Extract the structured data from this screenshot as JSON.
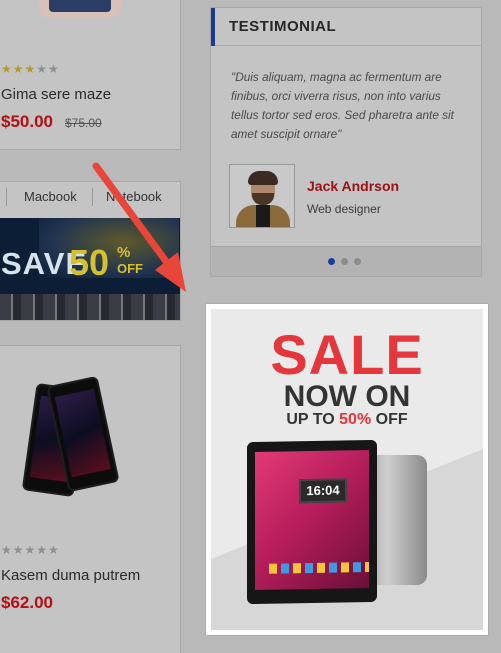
{
  "products": [
    {
      "name": "Gima sere maze",
      "price": "$50.00",
      "old_price": "$75.00",
      "rating": 3,
      "max_rating": 5
    },
    {
      "name": "Kasem duma putrem",
      "price": "$62.00",
      "old_price": "",
      "rating": 0,
      "max_rating": 5
    }
  ],
  "tabs": [
    "Macbook",
    "Notebook"
  ],
  "banner": {
    "save": "SAVE",
    "percent": "50",
    "percent_sign": "%",
    "off": "OFF"
  },
  "testimonial": {
    "title": "TESTIMONIAL",
    "quote": "\"Duis aliquam, magna ac fermentum are finibus, orci viverra risus, non into varius tellus tortor sed eros. Sed pharetra ante sit amet suscipit ornare\"",
    "author": "Jack Andrson",
    "role": "Web designer",
    "slides": 3,
    "active_slide": 0
  },
  "sale_ad": {
    "headline": "SALE",
    "line2": "NOW ON",
    "line3_prefix": "UP TO ",
    "line3_accent": "50%",
    "line3_suffix": " OFF",
    "clock": "16:04"
  },
  "colors": {
    "price_red": "#b50e13",
    "accent_red": "#e4363b",
    "brand_blue": "#1c3a8a",
    "arrow": "#e9463a"
  }
}
